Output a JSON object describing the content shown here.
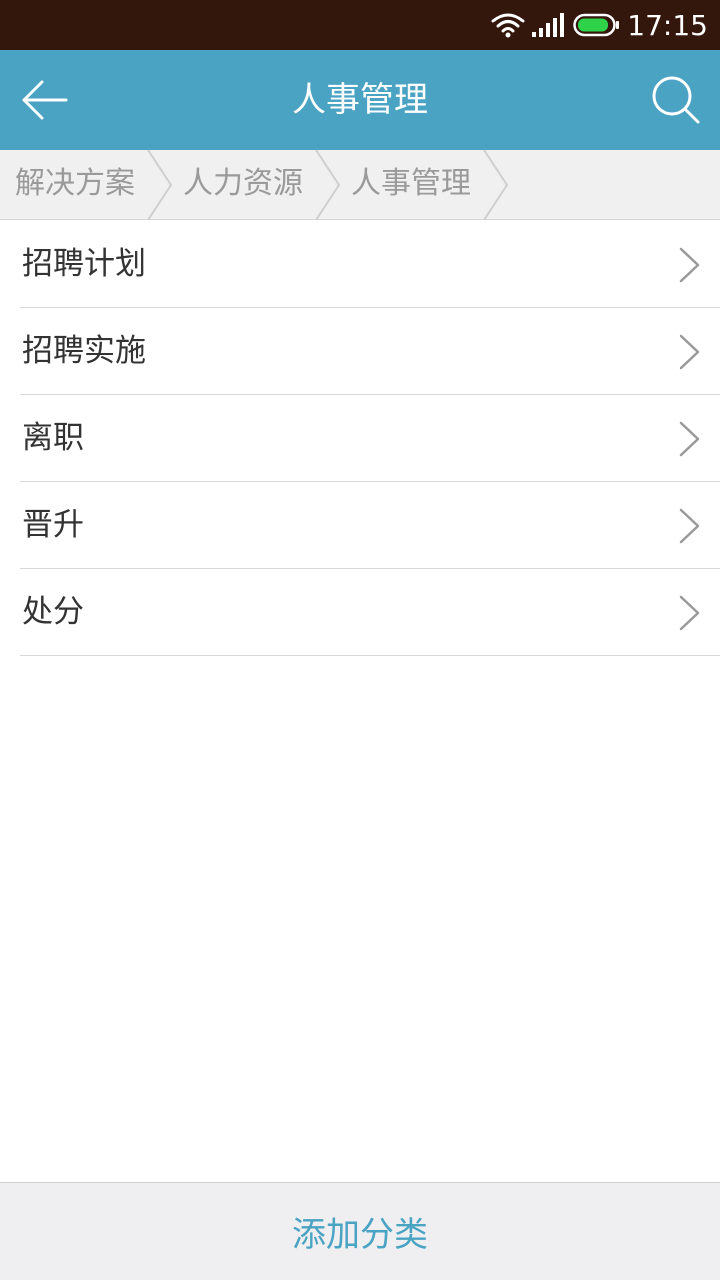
{
  "status_bar": {
    "time": "17:15",
    "icons": [
      "wifi-icon",
      "signal-icon",
      "battery-icon"
    ],
    "battery_color": "#2fd34a"
  },
  "header": {
    "title": "人事管理",
    "back_icon": "arrow-left-icon",
    "search_icon": "search-icon",
    "background": "#4aa3c3"
  },
  "breadcrumb": {
    "items": [
      {
        "label": "解决方案"
      },
      {
        "label": "人力资源"
      },
      {
        "label": "人事管理"
      }
    ]
  },
  "list": {
    "items": [
      {
        "label": "招聘计划"
      },
      {
        "label": "招聘实施"
      },
      {
        "label": "离职"
      },
      {
        "label": "晋升"
      },
      {
        "label": "处分"
      }
    ],
    "chevron_icon": "chevron-right-icon"
  },
  "footer": {
    "add_label": "添加分类",
    "accent": "#4aa3c3"
  }
}
